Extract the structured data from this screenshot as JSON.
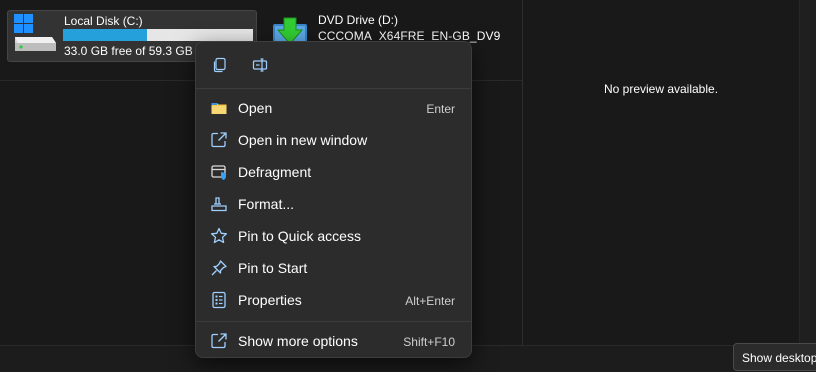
{
  "drives": [
    {
      "name": "Local Disk (C:)",
      "free_text": "33.0 GB free of 59.3 GB",
      "used_fraction": 0.44,
      "icon": "hard-drive-windows-icon"
    },
    {
      "name": "DVD Drive (D:)",
      "label": "CCCOMA_X64FRE_EN-GB_DV9",
      "icon": "dvd-drive-icon"
    }
  ],
  "preview": {
    "message": "No preview available."
  },
  "context_menu": {
    "quick_actions": [
      {
        "name": "copy",
        "icon": "copy-icon"
      },
      {
        "name": "rename",
        "icon": "rename-icon"
      }
    ],
    "items": [
      {
        "label": "Open",
        "shortcut": "Enter",
        "icon": "folder-icon"
      },
      {
        "label": "Open in new window",
        "shortcut": "",
        "icon": "open-new-window-icon"
      },
      {
        "label": "Defragment",
        "shortcut": "",
        "icon": "defragment-icon"
      },
      {
        "label": "Format...",
        "shortcut": "",
        "icon": "format-icon"
      },
      {
        "label": "Pin to Quick access",
        "shortcut": "",
        "icon": "star-icon"
      },
      {
        "label": "Pin to Start",
        "shortcut": "",
        "icon": "pin-icon"
      },
      {
        "label": "Properties",
        "shortcut": "Alt+Enter",
        "icon": "properties-icon"
      },
      {
        "label": "Show more options",
        "shortcut": "Shift+F10",
        "icon": "more-options-icon"
      }
    ]
  },
  "tooltip": {
    "text": "Show desktop"
  },
  "colors": {
    "accent": "#26a0da",
    "menu_bg": "#2c2c2c",
    "background": "#191919"
  }
}
